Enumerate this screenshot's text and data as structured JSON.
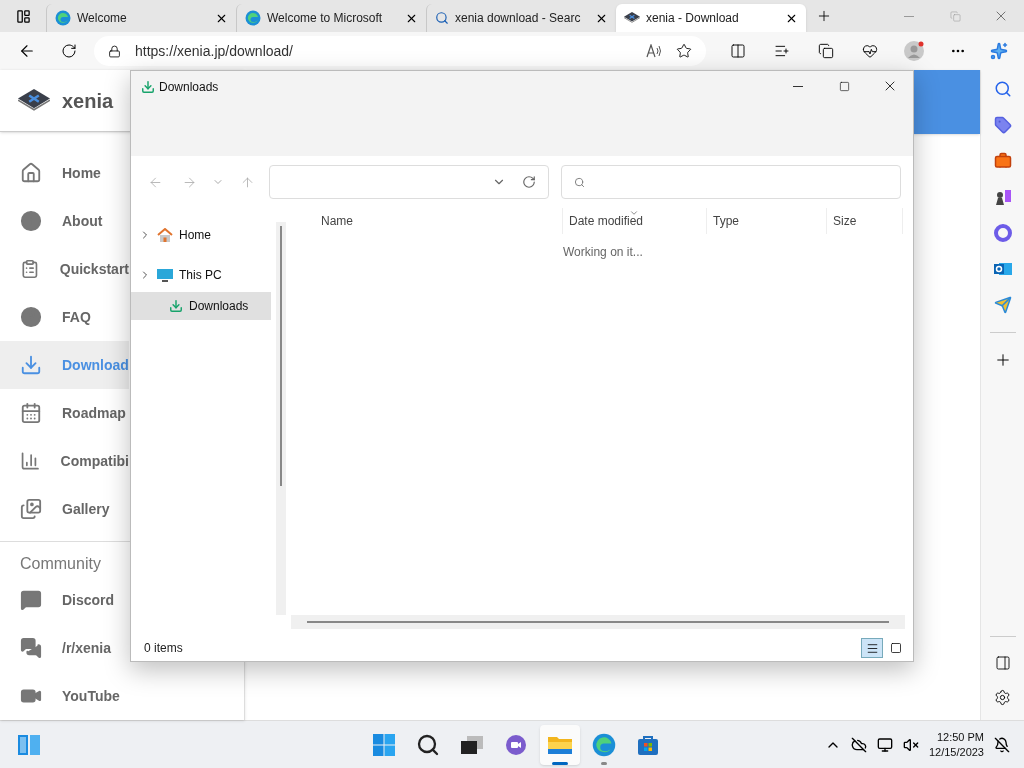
{
  "browser": {
    "tabs": [
      {
        "title": "Welcome",
        "kind": "edge",
        "selected": false
      },
      {
        "title": "Welcome to Microsoft",
        "kind": "edge",
        "selected": false
      },
      {
        "title": "xenia download - Searc",
        "kind": "search",
        "selected": false
      },
      {
        "title": "xenia - Download",
        "kind": "site",
        "selected": true
      }
    ],
    "address": "https://xenia.jp/download/"
  },
  "site": {
    "brand": "xenia",
    "nav": [
      {
        "label": "Home",
        "selected": false
      },
      {
        "label": "About",
        "selected": false
      },
      {
        "label": "Quickstart",
        "selected": false
      },
      {
        "label": "FAQ",
        "selected": false
      },
      {
        "label": "Download",
        "selected": true
      },
      {
        "label": "Roadmap",
        "selected": false
      },
      {
        "label": "Compatibi",
        "selected": false
      },
      {
        "label": "Gallery",
        "selected": false
      }
    ],
    "community_heading": "Community",
    "community": [
      {
        "label": "Discord"
      },
      {
        "label": "/r/xenia"
      },
      {
        "label": "YouTube"
      }
    ]
  },
  "explorer": {
    "title": "Downloads",
    "tree": [
      {
        "label": "Home",
        "expanded": false,
        "selected": false
      },
      {
        "label": "This PC",
        "expanded": false,
        "selected": false
      }
    ],
    "pinned": [
      {
        "label": "Downloads",
        "selected": true
      }
    ],
    "columns": [
      {
        "label": "Name",
        "sorted": false
      },
      {
        "label": "Date modified",
        "sorted": true
      },
      {
        "label": "Type",
        "sorted": false
      },
      {
        "label": "Size",
        "sorted": false
      }
    ],
    "status_text": "Working on it...",
    "item_count": "0 items",
    "views": [
      {
        "kind": "details",
        "selected": true
      },
      {
        "kind": "tiles",
        "selected": false
      }
    ]
  },
  "taskbar": {
    "apps": [
      {
        "kind": "start",
        "active": false,
        "running": false
      },
      {
        "kind": "search",
        "active": false,
        "running": false
      },
      {
        "kind": "taskview",
        "active": false,
        "running": false
      },
      {
        "kind": "chat",
        "active": false,
        "running": false
      },
      {
        "kind": "explorer",
        "active": true,
        "running": true
      },
      {
        "kind": "edge",
        "active": false,
        "running": true
      },
      {
        "kind": "store",
        "active": false,
        "running": false
      }
    ],
    "time": "12:50 PM",
    "date": "12/15/2023"
  }
}
